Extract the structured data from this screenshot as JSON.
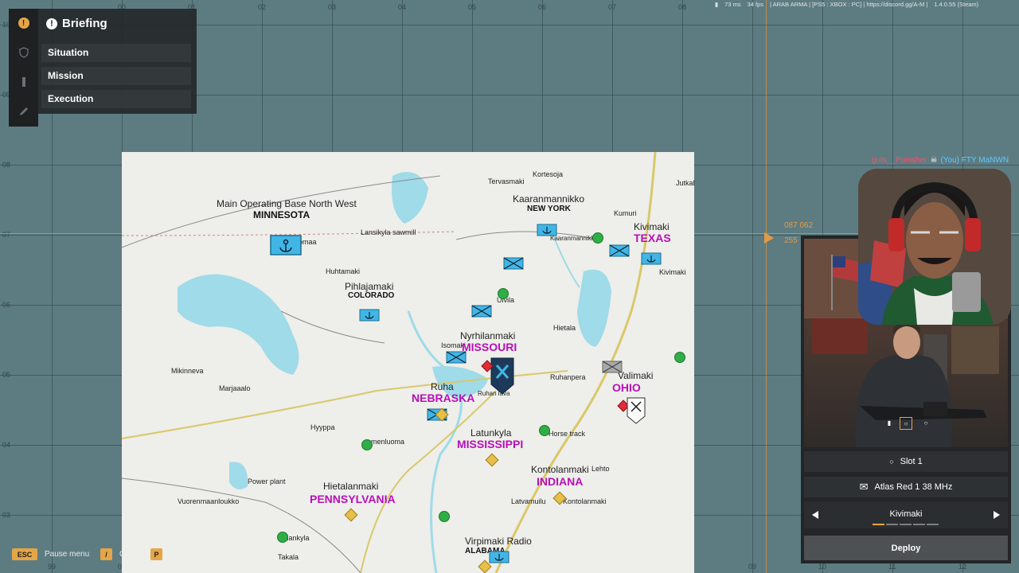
{
  "top_hud": {
    "ping": "73 ms",
    "fps": "34 fps",
    "server": "| ARAB ARMA | [PS5 : XBOX : PC] | https://discord.gg/A-M |",
    "version": "1.4.0.55 (Steam)"
  },
  "briefing": {
    "title": "Briefing",
    "items": [
      {
        "label": "Situation"
      },
      {
        "label": "Mission"
      },
      {
        "label": "Execution"
      }
    ],
    "side_icons": [
      "alert-icon",
      "shield-icon",
      "bar-icon",
      "pencil-icon"
    ]
  },
  "grid": {
    "top_labels": [
      "00",
      "01",
      "02",
      "03",
      "04",
      "05",
      "06",
      "07",
      "08"
    ],
    "bottom_labels": [
      "99",
      "00",
      "01",
      "09",
      "10",
      "11",
      "12"
    ],
    "left_labels": [
      "10",
      "09",
      "08",
      "07",
      "06",
      "05",
      "04",
      "03"
    ]
  },
  "map": {
    "places": [
      "Main Operating Base North West",
      "Lansikyla sawmill",
      "Huhtamaki",
      "Pihlajamaki",
      "Tervasmaki",
      "Kortesoja",
      "Kaaranmannikko",
      "Kumuri",
      "Kivimaki",
      "Kaaranmannikko",
      "Jutkallio",
      "Kivimaki",
      "Nyrhilanmaki",
      "Isomaki",
      "Uivila",
      "Hietala",
      "Valimaki",
      "Ruhanpera",
      "Ruha",
      "Ruhan lava",
      "Mikinneva",
      "Marjaaalo",
      "Hyyppa",
      "menluoma",
      "Latunkyla",
      "Horse track",
      "Kontolanmaki",
      "Lehto",
      "Power plant",
      "Vuorenmaanloukko",
      "Hietalanmaki",
      "Latvamuilu",
      "Kontolanmaki",
      "Virpimaki Radio",
      "Takala",
      "Jalankyla",
      "omaa"
    ],
    "bold_names": [
      "MINNESOTA",
      "NEW YORK",
      "COLORADO",
      "ALABAMA"
    ],
    "sectors": [
      "TEXAS",
      "MISSOURI",
      "NEBRASKA",
      "OHIO",
      "MISSISSIPPI",
      "INDIANA",
      "PENNSYLVANIA"
    ]
  },
  "bottom_keys": [
    {
      "key": "ESC",
      "label": "Pause menu"
    },
    {
      "key": "/",
      "label": "C"
    },
    {
      "key": "P",
      "label": ""
    }
  ],
  "chat": {
    "name": "guts__Punisher",
    "message": "(You) FTY MaNWN"
  },
  "cursor_readout": {
    "line1": "087 062",
    "line2": "255"
  },
  "deploy_panel": {
    "slot": "Slot 1",
    "radio": "Atlas Red 1 38 MHz",
    "spawn": "Kivimaki",
    "deploy_label": "Deploy"
  },
  "colors": {
    "sector": "#b80fb8",
    "accent": "#e6a546",
    "friendly": "#41b6e6"
  }
}
